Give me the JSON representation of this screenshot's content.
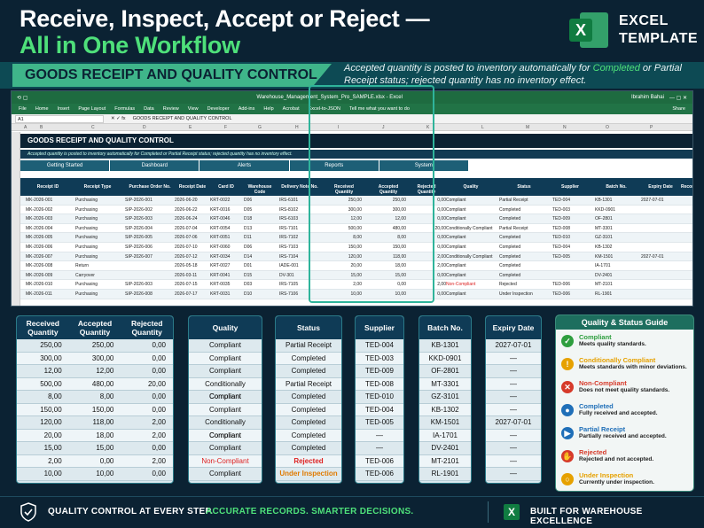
{
  "hero": {
    "line1": "Receive, Inspect, Accept or Reject —",
    "line2": "All in One Workflow"
  },
  "brand": {
    "line1": "EXCEL",
    "line2": "TEMPLATE",
    "icon": "excel-icon"
  },
  "banner": {
    "tag": "GOODS RECEIPT AND QUALITY CONTROL",
    "note_a": "Accepted quantity is posted to inventory automatically for ",
    "note_hl": "Completed",
    "note_b": " or Partial Receipt status; rejected quantity has no inventory effect."
  },
  "excel": {
    "filename": "Warehouse_Management_System_Pro_SAMPLE.xlsx  -  Excel",
    "user": "Ibrahim Bahai",
    "ribbon": [
      "File",
      "Home",
      "Insert",
      "Page Layout",
      "Formulas",
      "Data",
      "Review",
      "View",
      "Developer",
      "Add-ins",
      "Help",
      "Acrobat",
      "Excel-to-JSON",
      "Tell me what you want to do"
    ],
    "share": "Share",
    "namebox": "A1",
    "formula": "GOODS RECEIPT AND QUALITY CONTROL",
    "columns": [
      "A",
      "B",
      "C",
      "D",
      "E",
      "F",
      "G",
      "H",
      "I",
      "J",
      "K",
      "L",
      "M",
      "N",
      "O",
      "P"
    ],
    "sheet_title": "GOODS RECEIPT AND QUALITY CONTROL",
    "sheet_sub": "Accepted quantity is posted to inventory automatically for Completed or Partial Receipt status; rejected quantity has no inventory effect.",
    "nav": [
      "Getting Started",
      "Dashboard",
      "Alerts",
      "Reports",
      "System"
    ],
    "headers": [
      "Receipt ID",
      "Receipt Type",
      "Purchase Order No.",
      "Receipt Date",
      "Card ID",
      "Warehouse Code",
      "Delivery Note No.",
      "Received Quantity",
      "Accepted Quantity",
      "Rejected Quantity",
      "Quality",
      "Status",
      "Supplier",
      "Batch No.",
      "Expiry Date",
      "Records"
    ],
    "rows": [
      [
        "MK-2026-001",
        "Purchasing",
        "SIP-2026-001",
        "2026-06-20",
        "KRT-0022",
        "D06",
        "IRS-6101",
        "250,00",
        "250,00",
        "0,00",
        "Compliant",
        "Partial Receipt",
        "TED-004",
        "KB-1301",
        "2027-07-01"
      ],
      [
        "MK-2026-002",
        "Purchasing",
        "SIP-2026-002",
        "2026-06-22",
        "KRT-0016",
        "D05",
        "IRS-8102",
        "300,00",
        "300,00",
        "0,00",
        "Compliant",
        "Completed",
        "TED-003",
        "KKD-0901",
        ""
      ],
      [
        "MK-2026-003",
        "Purchasing",
        "SIP-2026-003",
        "2026-06-24",
        "KRT-0046",
        "D18",
        "IRS-6103",
        "12,00",
        "12,00",
        "0,00",
        "Compliant",
        "Completed",
        "TED-009",
        "OF-2801",
        ""
      ],
      [
        "MK-2026-004",
        "Purchasing",
        "SIP-2026-004",
        "2026-07-04",
        "KRT-0054",
        "D13",
        "IRS-7101",
        "500,00",
        "480,00",
        "20,00",
        "Conditionally Compliant",
        "Partial Receipt",
        "TED-008",
        "MT-3301",
        ""
      ],
      [
        "MK-2026-005",
        "Purchasing",
        "SIP-2026-005",
        "2026-07-06",
        "KRT-0051",
        "D11",
        "IRS-7102",
        "8,00",
        "8,00",
        "0,00",
        "Compliant",
        "Completed",
        "TED-010",
        "GZ-3101",
        ""
      ],
      [
        "MK-2026-006",
        "Purchasing",
        "SIP-2026-006",
        "2026-07-10",
        "KRT-0060",
        "D06",
        "IRS-7103",
        "150,00",
        "150,00",
        "0,00",
        "Compliant",
        "Completed",
        "TED-004",
        "KB-1302",
        ""
      ],
      [
        "MK-2026-007",
        "Purchasing",
        "SIP-2026-007",
        "2026-07-12",
        "KRT-0034",
        "D14",
        "IRS-7104",
        "120,00",
        "118,00",
        "2,00",
        "Conditionally Compliant",
        "Completed",
        "TED-005",
        "KM-1501",
        "2027-07-01"
      ],
      [
        "MK-2026-008",
        "Return",
        "",
        "2026-05-18",
        "KRT-0027",
        "D01",
        "IADE-001",
        "20,00",
        "18,00",
        "2,00",
        "Compliant",
        "Completed",
        "",
        "IA-1701",
        ""
      ],
      [
        "MK-2026-009",
        "Carryover",
        "",
        "2026-03-11",
        "KRT-0041",
        "D15",
        "DV-301",
        "15,00",
        "15,00",
        "0,00",
        "Compliant",
        "Completed",
        "",
        "DV-2401",
        ""
      ],
      [
        "MK-2026-010",
        "Purchasing",
        "SIP-2026-003",
        "2026-07-15",
        "KRT-0035",
        "D03",
        "IRS-7105",
        "2,00",
        "0,00",
        "2,00",
        "Non-Compliant",
        "Rejected",
        "TED-006",
        "MT-2101",
        ""
      ],
      [
        "MK-2026-011",
        "Purchasing",
        "SIP-2026-008",
        "2026-07-17",
        "KRT-0031",
        "D10",
        "IRS-7106",
        "10,00",
        "10,00",
        "0,00",
        "Compliant",
        "Under Inspection",
        "TED-006",
        "RL-1901",
        ""
      ]
    ]
  },
  "panels": {
    "qty_headers": [
      "Received Quantity",
      "Accepted Quantity",
      "Rejected Quantity"
    ],
    "qty_rows": [
      [
        "250,00",
        "250,00",
        "0,00"
      ],
      [
        "300,00",
        "300,00",
        "0,00"
      ],
      [
        "12,00",
        "12,00",
        "0,00"
      ],
      [
        "500,00",
        "480,00",
        "20,00"
      ],
      [
        "8,00",
        "8,00",
        "0,00"
      ],
      [
        "150,00",
        "150,00",
        "0,00"
      ],
      [
        "120,00",
        "118,00",
        "2,00"
      ],
      [
        "20,00",
        "18,00",
        "2,00"
      ],
      [
        "15,00",
        "15,00",
        "0,00"
      ],
      [
        "2,00",
        "0,00",
        "2,00"
      ],
      [
        "10,00",
        "10,00",
        "0,00"
      ]
    ],
    "quality_header": "Quality",
    "quality": [
      "Compliant",
      "Compliant",
      "Compliant",
      "Conditionally Compliant",
      "Compliant",
      "Compliant",
      "Conditionally Compliant",
      "Compliant",
      "Compliant",
      "Non-Compliant",
      "Compliant"
    ],
    "status_header": "Status",
    "status": [
      "Partial Receipt",
      "Completed",
      "Completed",
      "Partial Receipt",
      "Completed",
      "Completed",
      "Completed",
      "Completed",
      "Completed",
      "Rejected",
      "Under Inspection"
    ],
    "supplier_header": "Supplier",
    "supplier": [
      "TED-004",
      "TED-003",
      "TED-009",
      "TED-008",
      "TED-010",
      "TED-004",
      "TED-005",
      "—",
      "—",
      "TED-006",
      "TED-006"
    ],
    "batch_header": "Batch No.",
    "batch": [
      "KB-1301",
      "KKD-0901",
      "OF-2801",
      "MT-3301",
      "GZ-3101",
      "KB-1302",
      "KM-1501",
      "IA-1701",
      "DV-2401",
      "MT-2101",
      "RL-1901"
    ],
    "expiry_header": "Expiry Date",
    "expiry": [
      "2027-07-01",
      "—",
      "—",
      "—",
      "—",
      "—",
      "2027-07-01",
      "—",
      "—",
      "—",
      "—"
    ]
  },
  "guide": {
    "title": "Quality & Status Guide",
    "items": [
      {
        "t": "Compliant",
        "d": "Meets quality standards.",
        "color": "#2e9e3e",
        "icon": "check-icon",
        "glyph": "✓"
      },
      {
        "t": "Conditionally Compliant",
        "d": "Meets standards with minor deviations.",
        "color": "#e6a100",
        "icon": "warning-icon",
        "glyph": "!"
      },
      {
        "t": "Non-Compliant",
        "d": "Does not meet quality standards.",
        "color": "#d63a2a",
        "icon": "x-icon",
        "glyph": "✕"
      },
      {
        "t": "Completed",
        "d": "Fully received and accepted.",
        "color": "#1f6fb8",
        "icon": "completed-icon",
        "glyph": "●"
      },
      {
        "t": "Partial Receipt",
        "d": "Partially received and accepted.",
        "color": "#1f6fb8",
        "icon": "truck-icon",
        "glyph": "▶"
      },
      {
        "t": "Rejected",
        "d": "Rejected and not accepted.",
        "color": "#d63a2a",
        "icon": "hand-icon",
        "glyph": "✋"
      },
      {
        "t": "Under Inspection",
        "d": "Currently under inspection.",
        "color": "#e6a100",
        "icon": "magnifier-icon",
        "glyph": "○"
      }
    ]
  },
  "footer": {
    "a": "QUALITY CONTROL AT EVERY STEP.",
    "b": "ACCURATE RECORDS. SMARTER DECISIONS.",
    "c": "BUILT FOR WAREHOUSE EXCELLENCE"
  }
}
